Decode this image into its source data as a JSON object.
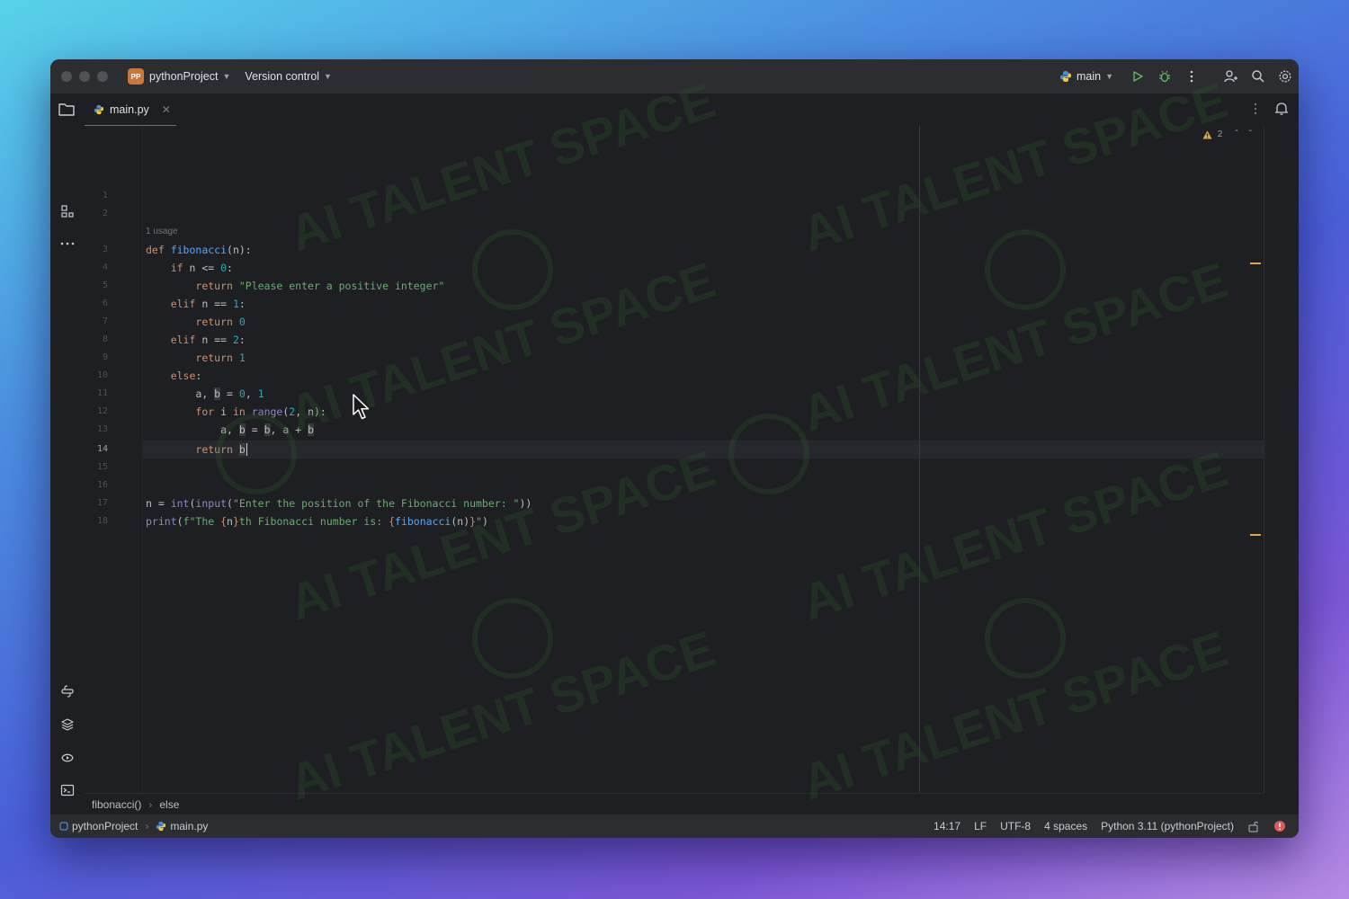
{
  "titlebar": {
    "project_badge": "PP",
    "project_name": "pythonProject",
    "vcs_label": "Version control",
    "branch": "main"
  },
  "tabs": [
    {
      "label": "main.py",
      "active": true
    }
  ],
  "editor": {
    "usage_hint": "1 usage",
    "current_line": 14,
    "line_numbers": [
      "1",
      "2",
      "3",
      "4",
      "5",
      "6",
      "7",
      "8",
      "9",
      "10",
      "11",
      "12",
      "13",
      "14",
      "15",
      "16",
      "17",
      "18"
    ],
    "problems": {
      "warnings": "2"
    }
  },
  "breadcrumbs": [
    "fibonacci()",
    "else"
  ],
  "statusbar": {
    "project": "pythonProject",
    "file": "main.py",
    "position": "14:17",
    "line_ending": "LF",
    "encoding": "UTF-8",
    "indent": "4 spaces",
    "interpreter": "Python 3.11 (pythonProject)"
  },
  "watermark": "AI TALENT SPACE",
  "colors": {
    "accent": "#3574f0",
    "keyword": "#cf8e6d",
    "string": "#6aab73",
    "number": "#2aacb8",
    "function": "#56a8f5",
    "warning": "#e6a14e"
  }
}
